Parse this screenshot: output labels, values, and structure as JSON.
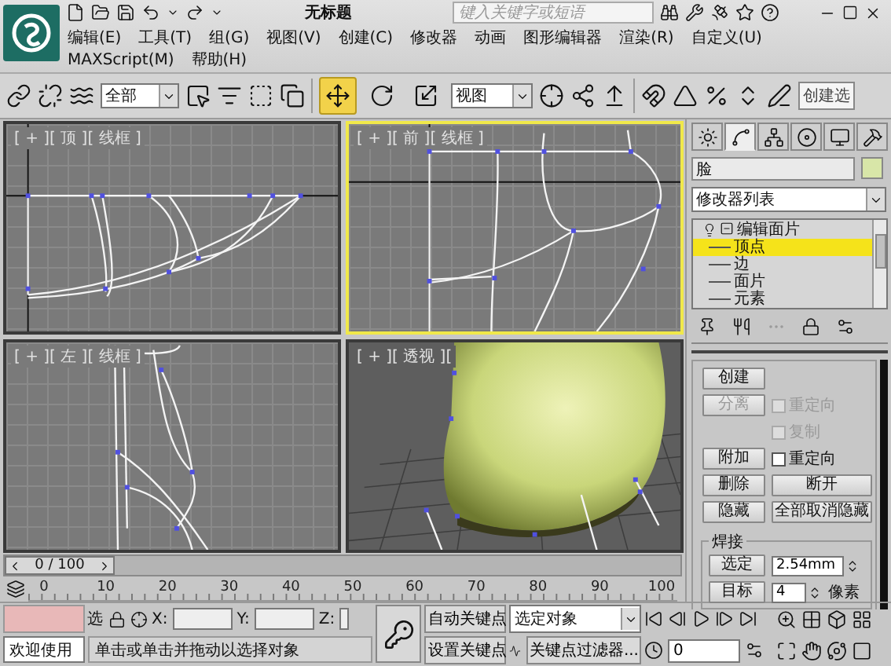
{
  "title_bar": {
    "title": "无标题",
    "search": {
      "placeholder": "键入关键字或短语"
    }
  },
  "menu": [
    {
      "label": "编辑(E)"
    },
    {
      "label": "工具(T)"
    },
    {
      "label": "组(G)"
    },
    {
      "label": "视图(V)"
    },
    {
      "label": "创建(C)"
    },
    {
      "label": "修改器"
    },
    {
      "label": "动画"
    },
    {
      "label": "图形编辑器"
    },
    {
      "label": "渲染(R)"
    },
    {
      "label": "自定义(U)"
    },
    {
      "label": "MAXScript(M)"
    },
    {
      "label": "帮助(H)"
    }
  ],
  "toolbar": {
    "selection_filter": "全部",
    "reference_coord": "视图",
    "named_selection": "创建选",
    "transform_tools": [
      {
        "kind": "move",
        "selected": true
      },
      {
        "kind": "rotate",
        "selected": false
      },
      {
        "kind": "scale",
        "selected": false
      }
    ]
  },
  "viewports": [
    {
      "label": "[ + ][ 顶 ][ 线框 ]",
      "kind": "top",
      "active": false
    },
    {
      "label": "[ + ][ 前 ][ 线框 ]",
      "kind": "front",
      "active": true
    },
    {
      "label": "[ + ][ 左 ][ 线框 ]",
      "kind": "left",
      "active": false
    },
    {
      "label": "[ + ][ 透视 ][ ",
      "kind": "perspective",
      "active": false
    }
  ],
  "timeline": {
    "frame": "0 / 100",
    "level": 0,
    "ticks": [
      "0",
      "10",
      "20",
      "30",
      "40",
      "50",
      "60",
      "70",
      "80",
      "90",
      "100"
    ]
  },
  "command_panel": {
    "tabs": [
      {
        "kind": "create",
        "selected": false
      },
      {
        "kind": "modify",
        "selected": true
      },
      {
        "kind": "hierarchy",
        "selected": false
      },
      {
        "kind": "motion",
        "selected": false
      },
      {
        "kind": "display",
        "selected": false
      },
      {
        "kind": "utilities",
        "selected": false
      }
    ],
    "object_name": "脸",
    "modifier_list": "修改器列表",
    "stack": [
      {
        "label": "编辑面片",
        "expanded": true,
        "selected": false,
        "children": [
          {
            "label": "顶点",
            "selected": true
          },
          {
            "label": "边",
            "selected": false
          },
          {
            "label": "面片",
            "selected": false
          },
          {
            "label": "元素",
            "selected": false
          }
        ]
      }
    ],
    "geometry_rows": [
      {
        "left": {
          "kind": "button",
          "label": "创建",
          "disabled": false
        }
      },
      {
        "left": {
          "kind": "button",
          "label": "分离",
          "disabled": true
        },
        "right": {
          "kind": "checkbox",
          "label": "重定向",
          "checked": false,
          "disabled": true
        }
      },
      {
        "right": {
          "kind": "checkbox",
          "label": "复制",
          "checked": false,
          "disabled": true
        }
      },
      {
        "left": {
          "kind": "button",
          "label": "附加",
          "disabled": false
        },
        "right": {
          "kind": "checkbox",
          "label": "重定向",
          "checked": false,
          "disabled": false
        }
      },
      {
        "left": {
          "kind": "button",
          "label": "删除",
          "disabled": false
        },
        "right": {
          "kind": "button",
          "label": "断开",
          "disabled": false
        }
      },
      {
        "left": {
          "kind": "button",
          "label": "隐藏",
          "disabled": false
        },
        "right": {
          "kind": "button",
          "label": "全部取消隐藏",
          "disabled": false
        }
      }
    ],
    "weld": {
      "title": "焊接",
      "rows": [
        {
          "button": "选定",
          "value": "2.54mm"
        },
        {
          "button": "目标",
          "value": "4",
          "unit": "像素"
        }
      ]
    }
  },
  "status_bar": {
    "listener": "欢迎使用",
    "selection_lock": "选",
    "x_label": "X:",
    "y_label": "Y:",
    "z_label": "Z:",
    "prompt": "单击或单击并拖动以选择对象",
    "auto_key": "自动关键点",
    "set_key": "设置关键点",
    "key_set": "选定对象",
    "key_filters": "关键点过滤器...",
    "frame": "0"
  }
}
